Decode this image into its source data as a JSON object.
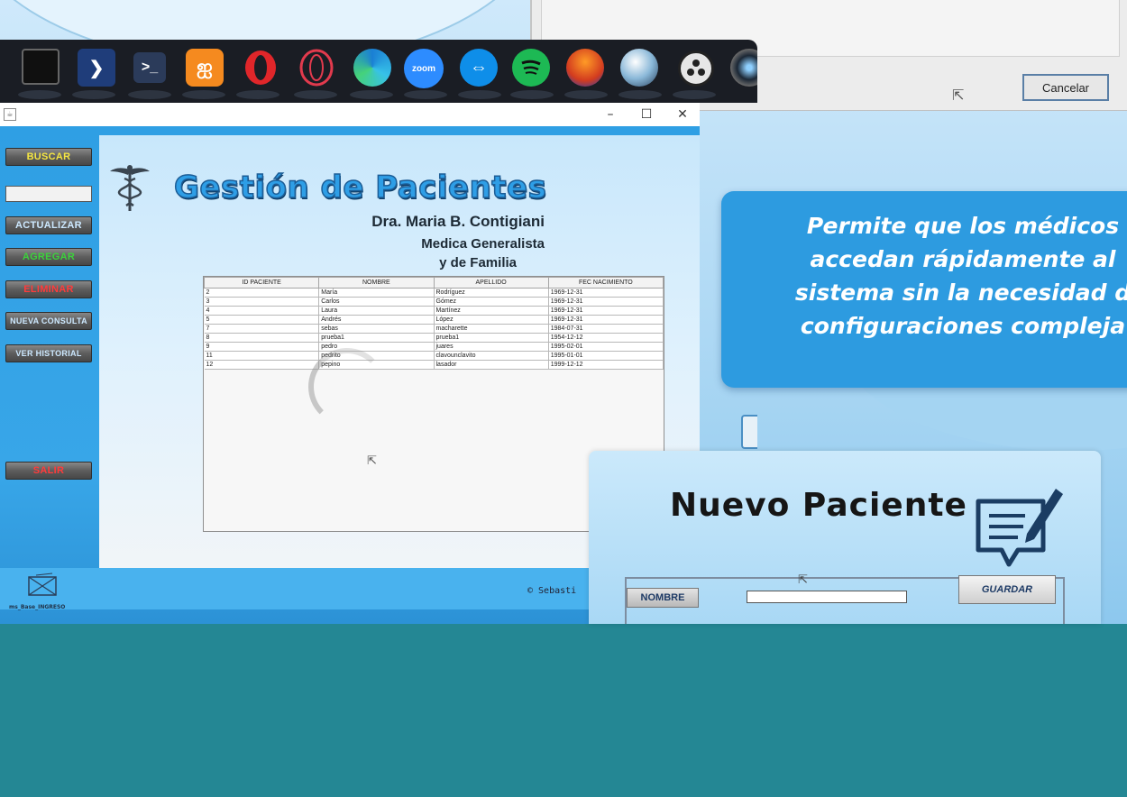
{
  "dialog_fragment": {
    "cancel_label": "Cancelar"
  },
  "dock": {
    "icons": [
      "terminal-icon",
      "powershell-icon",
      "console-icon",
      "xampp-icon",
      "opera-icon",
      "opera-gx-icon",
      "edge-icon",
      "zoom-icon",
      "teamviewer-icon",
      "spotify-icon",
      "audacity-icon",
      "cpu-z-icon",
      "obs-icon",
      "camera-icon"
    ],
    "zoom_label": "zoom"
  },
  "window": {
    "title": "",
    "controls": {
      "minimize": "–",
      "maximize": "☐",
      "close": "✕"
    }
  },
  "sidebar": {
    "buttons": [
      {
        "label": "BUSCAR",
        "color": "#f5e642"
      },
      {
        "label": "ACTUALIZAR",
        "color": "#cde9ff"
      },
      {
        "label": "AGREGAR",
        "color": "#3cd13c"
      },
      {
        "label": "ELIMINAR",
        "color": "#ff3b3b"
      },
      {
        "label": "NUEVA CONSULTA",
        "color": "#cde9ff"
      },
      {
        "label": "VER HISTORIAL",
        "color": "#cde9ff"
      },
      {
        "label": "SALIR",
        "color": "#ff3b3b"
      }
    ],
    "search_value": ""
  },
  "header": {
    "title": "Gestión de Pacientes",
    "doctor": "Dra. Maria B. Contigiani",
    "specialty_line1": "Medica Generalista",
    "specialty_line2": "y de Familia"
  },
  "table": {
    "columns": [
      "ID PACIENTE",
      "NOMBRE",
      "APELLIDO",
      "FEC NACIMIENTO"
    ],
    "rows": [
      [
        "2",
        "María",
        "Rodríguez",
        "1969-12-31"
      ],
      [
        "3",
        "Carlos",
        "Gómez",
        "1969-12-31"
      ],
      [
        "4",
        "Laura",
        "Martínez",
        "1969-12-31"
      ],
      [
        "5",
        "Andrés",
        "López",
        "1969-12-31"
      ],
      [
        "7",
        "sebas",
        "macharette",
        "1984-07-31"
      ],
      [
        "8",
        "prueba1",
        "prueba1",
        "1954-12-12"
      ],
      [
        "9",
        "pedro",
        "juares",
        "1995-02-01"
      ],
      [
        "11",
        "pedrito",
        "clavounclavito",
        "1995-01-01"
      ],
      [
        "12",
        "pepino",
        "lasador",
        "1999-12-12"
      ]
    ]
  },
  "footer": {
    "credit": "© Sebasti",
    "logo_caption": "ms_Base_INGRESO"
  },
  "caption": {
    "lines": [
      "Permite que los médicos",
      "accedan rápidamente al",
      "sistema sin la necesidad d",
      "configuraciones compleja"
    ]
  },
  "new_patient": {
    "title": "Nuevo Paciente",
    "name_label": "NOMBRE",
    "name_value": "",
    "save_label": "GUARDAR"
  },
  "colors": {
    "accent": "#2d9be0",
    "bottom_band": "#248794",
    "title_blue": "#2e9ee6"
  }
}
